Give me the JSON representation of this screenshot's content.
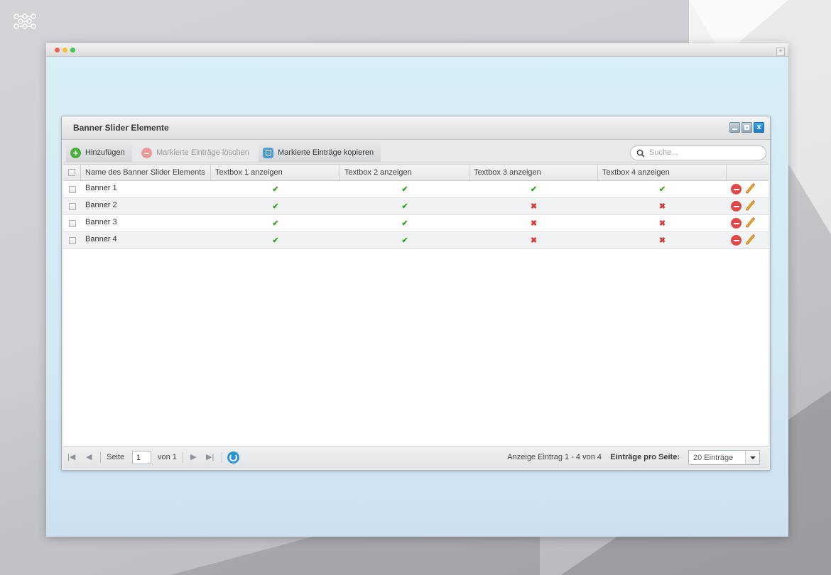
{
  "window": {
    "title": "Banner Slider Elemente"
  },
  "toolbar": {
    "add_label": "Hinzufügen",
    "delete_label": "Markierte Einträge löschen",
    "copy_label": "Markierte Einträge kopieren",
    "search_placeholder": "Suche..."
  },
  "table": {
    "columns": [
      "Name des Banner Slider Elements",
      "Textbox 1 anzeigen",
      "Textbox 2 anzeigen",
      "Textbox 3 anzeigen",
      "Textbox 4 anzeigen"
    ],
    "rows": [
      {
        "name": "Banner 1",
        "tb1": true,
        "tb2": true,
        "tb3": true,
        "tb4": true
      },
      {
        "name": "Banner 2",
        "tb1": true,
        "tb2": true,
        "tb3": false,
        "tb4": false
      },
      {
        "name": "Banner 3",
        "tb1": true,
        "tb2": true,
        "tb3": false,
        "tb4": false
      },
      {
        "name": "Banner 4",
        "tb1": true,
        "tb2": true,
        "tb3": false,
        "tb4": false
      }
    ]
  },
  "pager": {
    "page_label": "Seite",
    "page_value": "1",
    "of_label": "von 1",
    "info": "Anzeige Eintrag 1 - 4 von 4",
    "per_page_label": "Einträge pro Seite:",
    "per_page_value": "20 Einträge"
  },
  "colors": {
    "check": "#3b9b23",
    "cross": "#d83a3a",
    "accent": "#2c93d4"
  }
}
